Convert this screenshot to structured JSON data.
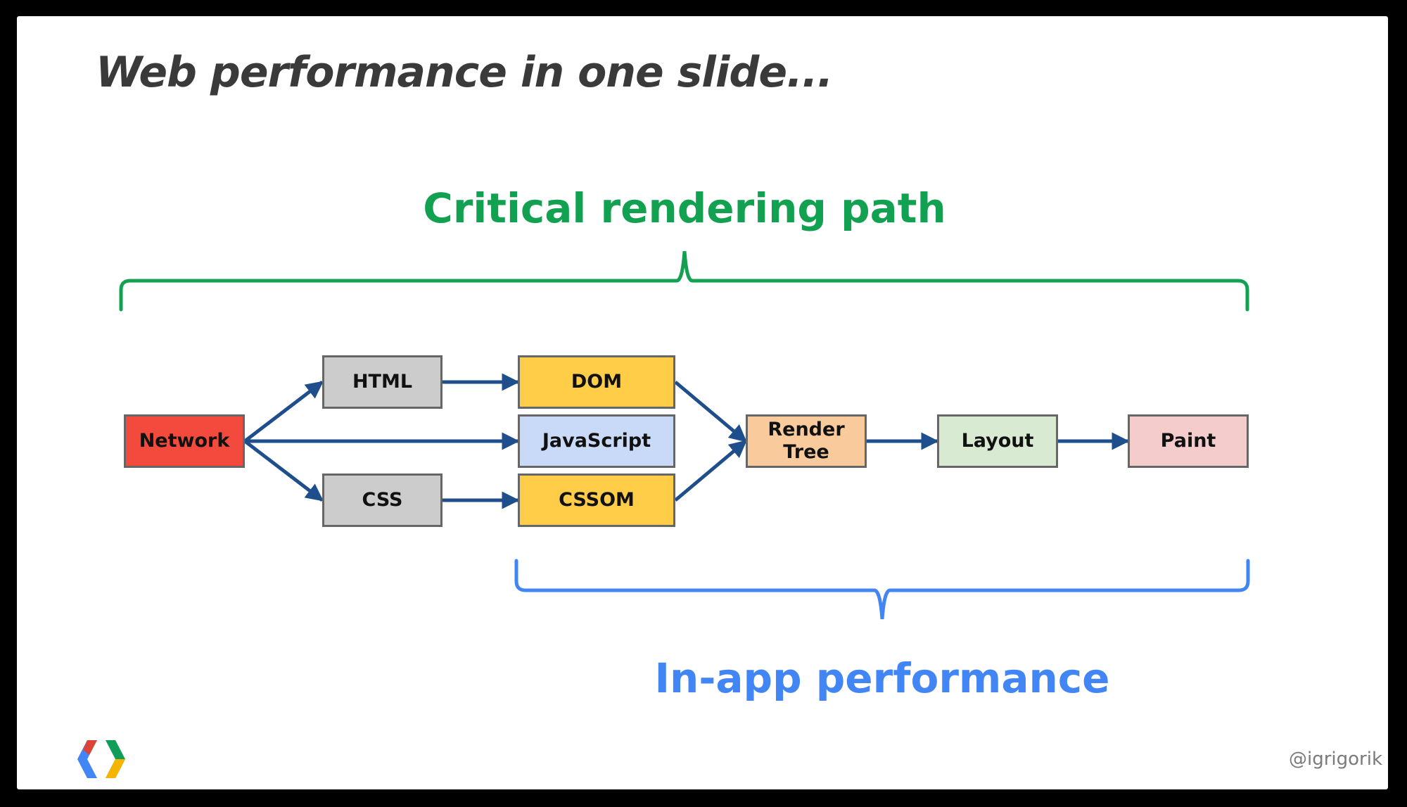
{
  "slide": {
    "title": "Web performance in one slide...",
    "top_label": "Critical rendering path",
    "bottom_label": "In-app performance",
    "handle": "@igrigorik",
    "logo": "google-developers-logo"
  },
  "colors": {
    "top_brace": "#12a150",
    "bottom_brace": "#4285f4",
    "arrow": "#1f4e8c"
  },
  "nodes": {
    "network": {
      "label": "Network",
      "color": "#f24a3d"
    },
    "html": {
      "label": "HTML",
      "color": "#cccccc"
    },
    "css": {
      "label": "CSS",
      "color": "#cccccc"
    },
    "dom": {
      "label": "DOM",
      "color": "#ffcd48"
    },
    "javascript": {
      "label": "JavaScript",
      "color": "#c9daf8"
    },
    "cssom": {
      "label": "CSSOM",
      "color": "#ffcd48"
    },
    "render_tree": {
      "label": "Render Tree",
      "color": "#f9cb9c"
    },
    "layout": {
      "label": "Layout",
      "color": "#d9ead3"
    },
    "paint": {
      "label": "Paint",
      "color": "#f4cccc"
    }
  },
  "edges": [
    [
      "network",
      "html"
    ],
    [
      "network",
      "javascript"
    ],
    [
      "network",
      "css"
    ],
    [
      "html",
      "dom"
    ],
    [
      "css",
      "cssom"
    ],
    [
      "dom",
      "render_tree"
    ],
    [
      "cssom",
      "render_tree"
    ],
    [
      "render_tree",
      "layout"
    ],
    [
      "layout",
      "paint"
    ]
  ]
}
